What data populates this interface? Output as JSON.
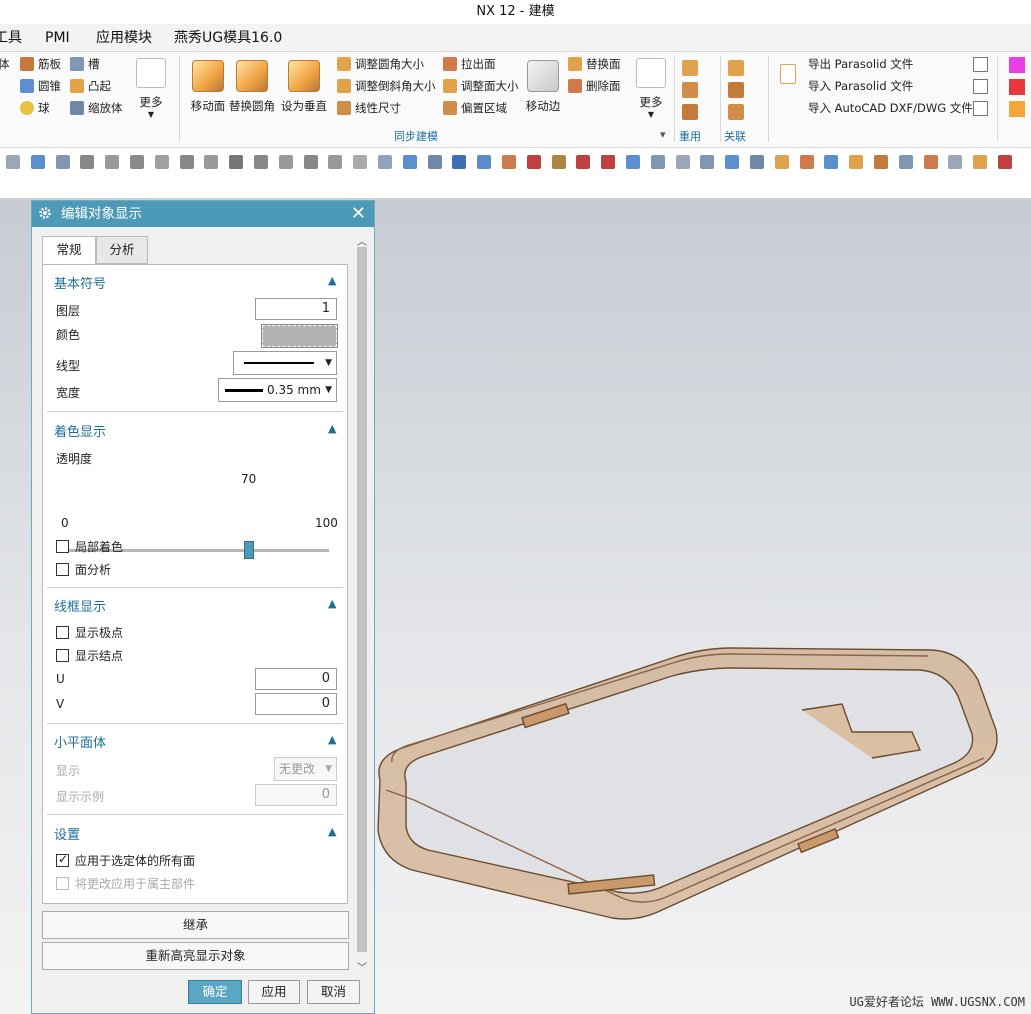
{
  "window": {
    "title": "NX 12 - 建模"
  },
  "menubar": {
    "items": [
      "工具",
      "PMI",
      "应用模块",
      "燕秀UG模具16.0"
    ]
  },
  "ribbon": {
    "small_left": [
      "体",
      "筋板",
      "槽",
      "圆锥",
      "凸起",
      "球",
      "缩放体"
    ],
    "more_label": "更多",
    "big_buttons": [
      "移动面",
      "替换圆角",
      "设为垂直"
    ],
    "sync_small": [
      "调整圆角大小",
      "调整倒斜角大小",
      "线性尺寸",
      "拉出面",
      "调整面大小",
      "偏置区域"
    ],
    "move_edge": "移动边",
    "sync_small2": [
      "替换面",
      "删除面"
    ],
    "more2_label": "更多",
    "group_sync": "同步建模",
    "group_reuse": "重用",
    "group_assoc": "关联",
    "export_items": [
      "导出 Parasolid 文件",
      "导入 Parasolid 文件",
      "导入 AutoCAD DXF/DWG 文件"
    ],
    "swatch_colors": [
      "#e83fe8",
      "#e8383b",
      "#f2a737"
    ]
  },
  "graphics": {
    "watermark": "UG爱好者论坛 WWW.UGSNX.COM",
    "model_color": "#c9996c"
  },
  "dialog": {
    "title": "编辑对象显示",
    "tabs": [
      "常规",
      "分析"
    ],
    "sec_basic": {
      "header": "基本符号",
      "layer_label": "图层",
      "layer_value": "1",
      "color_label": "颜色",
      "linetype_label": "线型",
      "width_label": "宽度",
      "width_value": "0.35 mm"
    },
    "sec_shading": {
      "header": "着色显示",
      "transparency_label": "透明度",
      "transparency_value": "70",
      "transparency_level": 70,
      "min": "0",
      "max": "100",
      "partial_shading": "局部着色",
      "face_analysis": "面分析"
    },
    "sec_wireframe": {
      "header": "线框显示",
      "show_poles": "显示极点",
      "show_knots": "显示结点",
      "u_label": "U",
      "u_value": "0",
      "v_label": "V",
      "v_value": "0"
    },
    "sec_facet": {
      "header": "小平面体",
      "display_label": "显示",
      "display_value": "无更改",
      "example_label": "显示示例",
      "example_value": "0"
    },
    "sec_settings": {
      "header": "设置",
      "apply_all_faces": "应用于选定体的所有面",
      "apply_to_owner": "将更改应用于属主部件"
    },
    "inherit_label": "继承",
    "rehighlight_label": "重新高亮显示对象",
    "ok_label": "确定",
    "apply_label": "应用",
    "cancel_label": "取消"
  }
}
